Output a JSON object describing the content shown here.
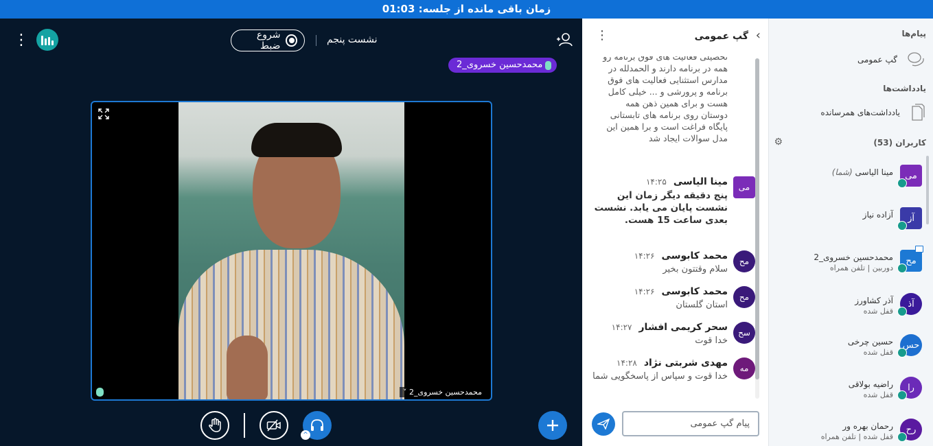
{
  "banner": {
    "text": "زمان باقی مانده از جلسه: 01:03"
  },
  "stage": {
    "session_title": "نشست پنجم",
    "record_label": "شروع ضبط",
    "speaker_chip": "محمدحسین خسروی_2",
    "video_label": "محمدحسین خسروی_2"
  },
  "chat": {
    "title": "گپ عمومی",
    "continued_text": "تحصیلی فعالیت های فوق برنامه رو همه در برنامه دارند و الحمدلله در مدارس استثنایی فعالیت های فوق برنامه و پرورشی و ... خیلی کامل هست و برای همین ذهن همه دوستان روی برنامه های تابستانی پایگاه فراغت است و برا همین این مدل سوالات ایجاد شد",
    "messages": [
      {
        "avatar": "می",
        "color": "#7b2cb8",
        "square": true,
        "name": "مینا الیاسی",
        "time": "۱۴:۲۵",
        "text": "پنج دقیقه دیگر زمان این نشست پایان می یابد. نشست بعدی ساعت 15 هست.",
        "bold": true
      },
      {
        "avatar": "مح",
        "color": "#3a1a7a",
        "square": false,
        "name": "محمد کابوسی",
        "time": "۱۴:۲۶",
        "text": "سلام وقتتون بخیر",
        "bold": false
      },
      {
        "avatar": "مح",
        "color": "#3a1a7a",
        "square": false,
        "name": "محمد کابوسی",
        "time": "۱۴:۲۶",
        "text": "استان گلستان",
        "bold": false
      },
      {
        "avatar": "سح",
        "color": "#3a1a7a",
        "square": false,
        "name": "سحر کریمی افشار",
        "time": "۱۴:۲۷",
        "text": "خدا قوت",
        "bold": false
      },
      {
        "avatar": "مه",
        "color": "#6e1a7a",
        "square": false,
        "name": "مهدی شربتی نژاد",
        "time": "۱۴:۲۸",
        "text": "خدا قوت و سپاس از پاسخگویی شما",
        "bold": false
      }
    ],
    "input_placeholder": "پیام گپ عمومی"
  },
  "sidebar": {
    "messages_heading": "پیام‌ها",
    "public_chat": "گپ عمومی",
    "notes_heading": "یادداشت‌ها",
    "shared_notes": "یادداشت‌های همرسانده",
    "users_heading": "کاربران (53)",
    "users": [
      {
        "avatar": "می",
        "color": "#7b2cb8",
        "square": true,
        "presenter": false,
        "name": "مینا الیاسی",
        "you": "(شما)",
        "status": ""
      },
      {
        "avatar": "آز",
        "color": "#3a3aa8",
        "square": true,
        "presenter": false,
        "name": "آزاده نیاز",
        "you": "",
        "status": ""
      },
      {
        "avatar": "مح",
        "color": "#1d79d4",
        "square": true,
        "presenter": true,
        "name": "محمدحسین خسروی_2",
        "you": "",
        "status": "دوربین | تلفن همراه"
      },
      {
        "avatar": "آذ",
        "color": "#3a1a9a",
        "square": false,
        "presenter": false,
        "name": "آذر کشاورز",
        "you": "",
        "status": "قفل شده"
      },
      {
        "avatar": "حس",
        "color": "#1d6fd0",
        "square": false,
        "presenter": false,
        "name": "حسین چرخی",
        "you": "",
        "status": "قفل شده"
      },
      {
        "avatar": "را",
        "color": "#6b2bb8",
        "square": false,
        "presenter": false,
        "name": "راضیه بولاقی",
        "you": "",
        "status": "قفل شده"
      },
      {
        "avatar": "رح",
        "color": "#5a1aa0",
        "square": false,
        "presenter": false,
        "name": "رحمان بهره ور",
        "you": "",
        "status": "قفل شده | تلفن همراه"
      }
    ]
  }
}
